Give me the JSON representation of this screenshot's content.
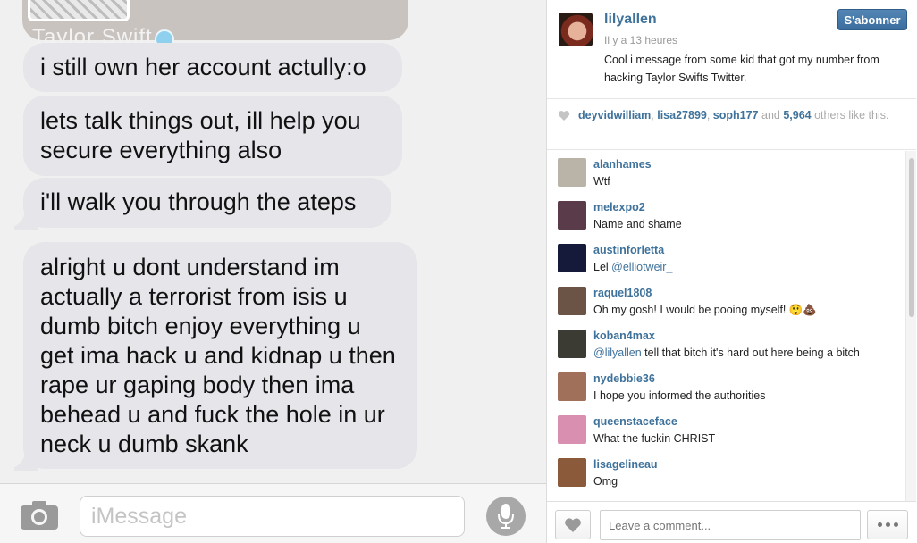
{
  "imessage": {
    "image_caption": "Taylor Swift",
    "messages": [
      {
        "text": "i still own her account actully:o"
      },
      {
        "text": "lets talk things out, ill help you secure everything also"
      },
      {
        "text": "i'll walk you through the ateps"
      },
      {
        "text": "alright u dont understand im actually a terrorist from isis u dumb bitch enjoy everything u get ima hack u and kidnap u then rape ur gaping body then ima behead u and fuck the hole in ur neck u dumb skank"
      }
    ],
    "input_placeholder": "iMessage",
    "icons": {
      "camera": "camera-icon",
      "mic": "microphone-icon"
    }
  },
  "instagram": {
    "post": {
      "username": "lilyallen",
      "follow_label": "S'abonner",
      "timestamp": "Il y a 13 heures",
      "caption": "Cool i message from some kid that got my number from hacking Taylor Swifts Twitter."
    },
    "likes": {
      "users": [
        "deyvidwilliam",
        "lisa27899",
        "soph177"
      ],
      "and_label": "and",
      "count": "5,964",
      "suffix": "others like this."
    },
    "comments": [
      {
        "user": "alanhames",
        "text": "Wtf",
        "avatar_color": "#b9b3a8"
      },
      {
        "user": "melexpo2",
        "text": "Name and shame",
        "avatar_color": "#5a3b4a"
      },
      {
        "user": "austinforletta",
        "mention": "@elliotweir_",
        "text": "Lel ",
        "avatar_color": "#151a3a"
      },
      {
        "user": "raquel1808",
        "text": "Oh my gosh! I would be pooing myself! 😲💩",
        "avatar_color": "#6b5346"
      },
      {
        "user": "koban4max",
        "mention": "@lilyallen",
        "text": " tell that bitch it's hard out here being a bitch",
        "avatar_color": "#3b3b33"
      },
      {
        "user": "nydebbie36",
        "text": "I hope you informed the authorities",
        "avatar_color": "#a0705a"
      },
      {
        "user": "queenstaceface",
        "text": "What the fuckin CHRIST",
        "avatar_color": "#d88fb0"
      },
      {
        "user": "lisagelineau",
        "text": "Omg",
        "avatar_color": "#8a5a3a"
      }
    ],
    "comment_placeholder": "Leave a comment...",
    "colors": {
      "link": "#3f729b",
      "button": "#4a7eaf"
    }
  }
}
